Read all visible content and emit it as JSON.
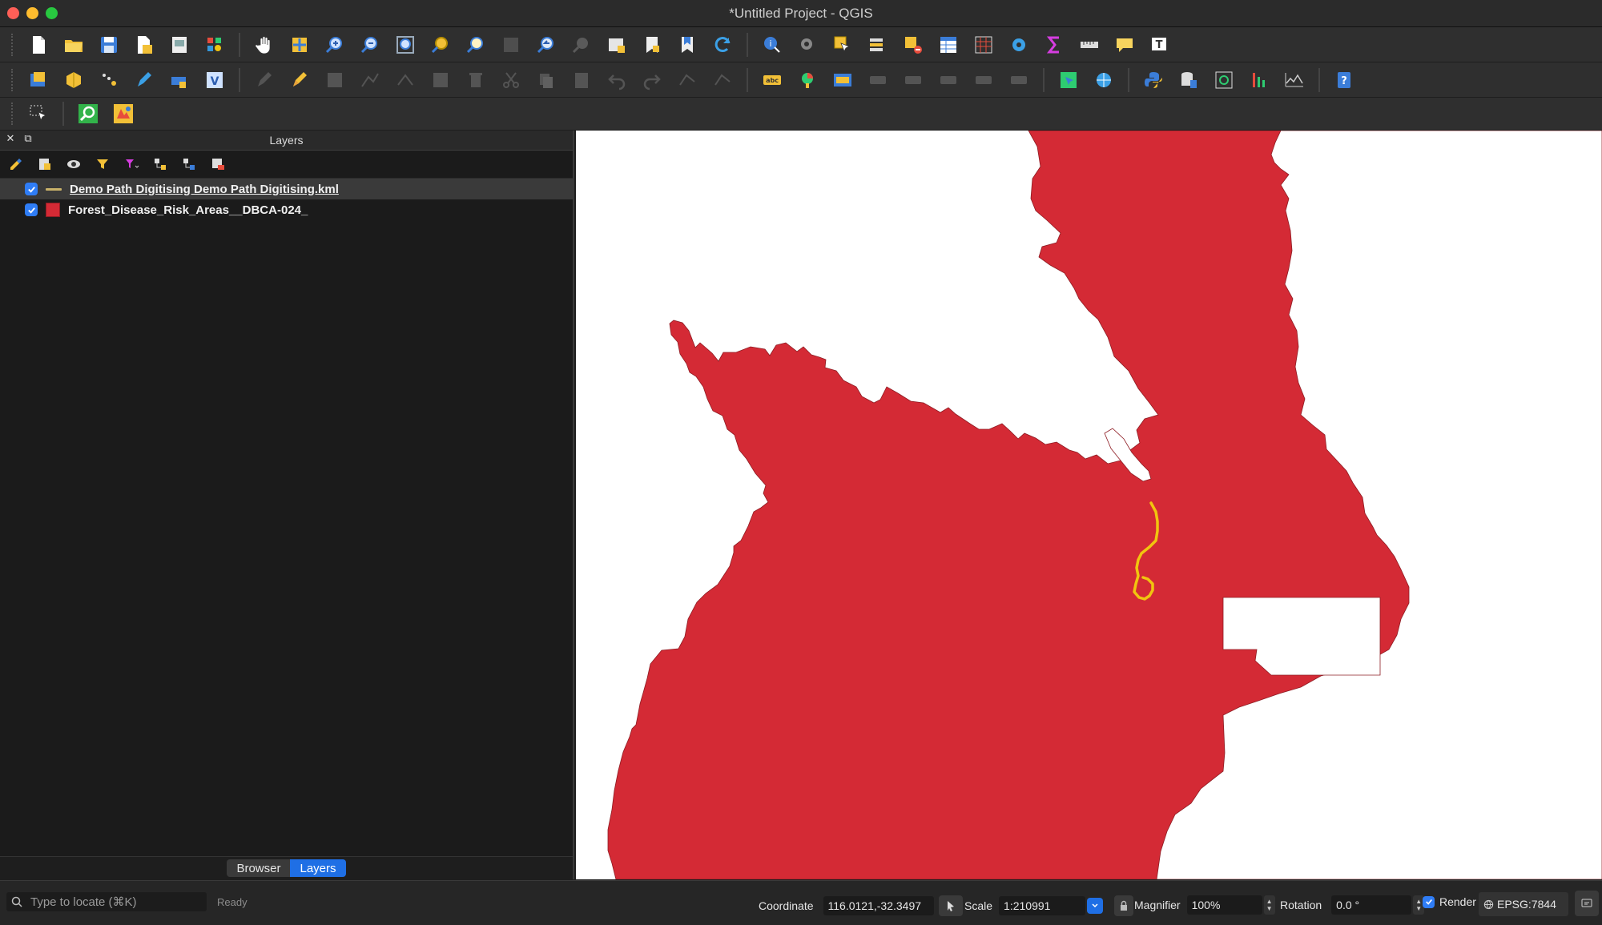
{
  "window": {
    "title": "*Untitled Project - QGIS"
  },
  "layers_panel": {
    "title": "Layers",
    "layers": [
      {
        "name": "Demo Path Digitising Demo Path Digitising.kml",
        "checked": true,
        "symbol": "line",
        "color": "#c9b26a"
      },
      {
        "name": "Forest_Disease_Risk_Areas__DBCA-024_",
        "checked": true,
        "symbol": "fill",
        "color": "#d42a35"
      }
    ],
    "tabs": {
      "browser": "Browser",
      "layers": "Layers"
    }
  },
  "map": {
    "polygon_fill": "#d42a35",
    "path_color": "#f1c40f",
    "background": "#ffffff"
  },
  "statusbar": {
    "locator_placeholder": "Type to locate (⌘K)",
    "ready": "Ready",
    "coordinate_label": "Coordinate",
    "coordinate_value": "116.0121,-32.3497",
    "scale_label": "Scale",
    "scale_value": "1:210991",
    "magnifier_label": "Magnifier",
    "magnifier_value": "100%",
    "rotation_label": "Rotation",
    "rotation_value": "0.0 °",
    "render_label": "Render",
    "render_checked": true,
    "crs": "EPSG:7844"
  }
}
